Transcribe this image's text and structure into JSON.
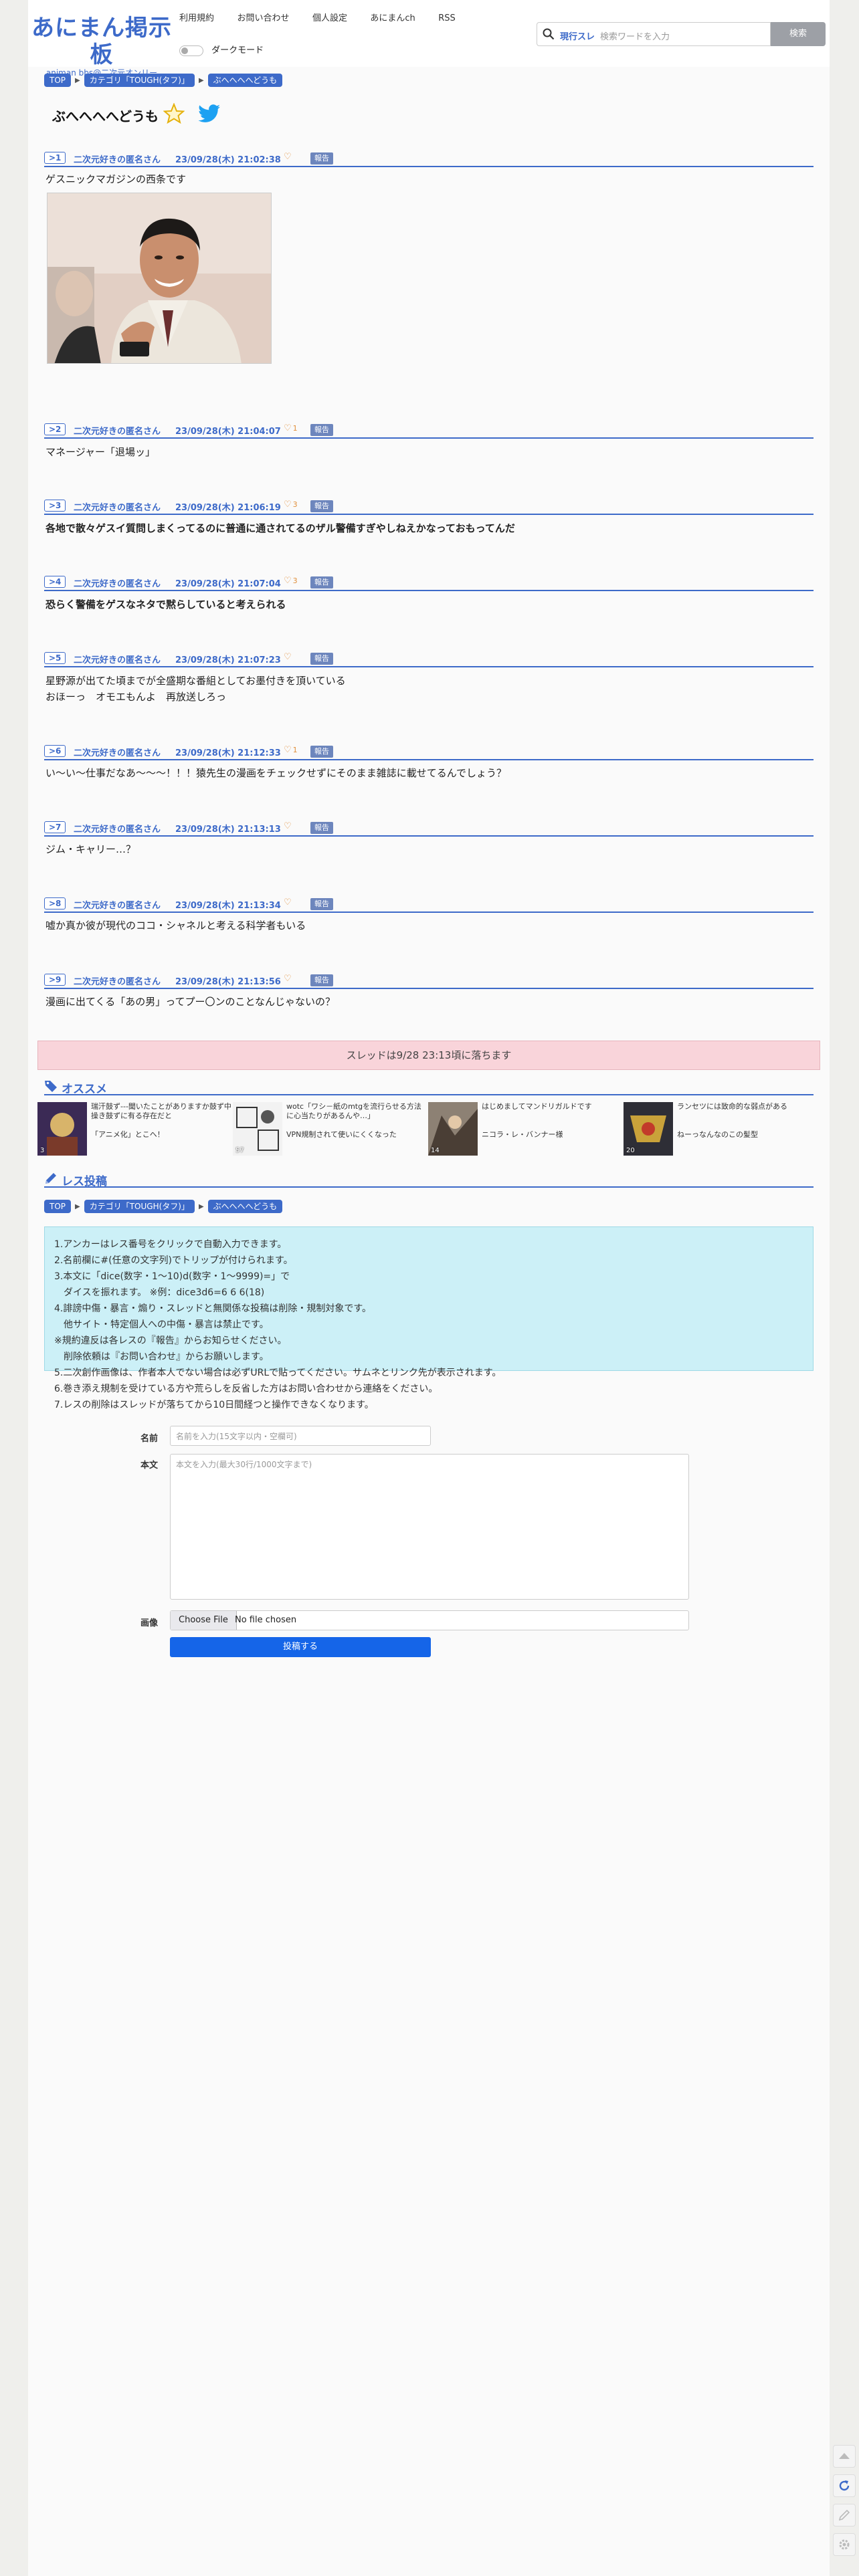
{
  "header": {
    "logo_title": "あにまん掲示板",
    "logo_sub": "animan bbs@二次元オンリー",
    "nav": [
      "利用規約",
      "お問い合わせ",
      "個人設定",
      "あにまんch",
      "RSS"
    ],
    "dark_mode_label": "ダークモード",
    "search_scope": "現行スレ",
    "search_placeholder": "検索ワードを入力",
    "search_button": "検索"
  },
  "breadcrumb": {
    "top": "TOP",
    "category": "カテゴリ「TOUGH(タフ)」",
    "thread": "ぶへへへへどうも"
  },
  "thread": {
    "title": "ぶへへへへどうも",
    "report_label": "報告",
    "posts": [
      {
        "num": "1",
        "name": "二次元好きの匿名さん",
        "date": "23/09/28(木) 21:02:38",
        "likes": "",
        "text": "ゲスニックマガジンの西条です"
      },
      {
        "num": "2",
        "name": "二次元好きの匿名さん",
        "date": "23/09/28(木) 21:04:07",
        "likes": "1",
        "text": "マネージャー「退場ッ」"
      },
      {
        "num": "3",
        "name": "二次元好きの匿名さん",
        "date": "23/09/28(木) 21:06:19",
        "likes": "3",
        "text": "各地で散々ゲスイ質問しまくってるのに普通に通されてるのザル警備すぎやしねえかなっておもってんだ"
      },
      {
        "num": "4",
        "name": "二次元好きの匿名さん",
        "date": "23/09/28(木) 21:07:04",
        "likes": "3",
        "text": "恐らく警備をゲスなネタで黙らしていると考えられる"
      },
      {
        "num": "5",
        "name": "二次元好きの匿名さん",
        "date": "23/09/28(木) 21:07:23",
        "likes": "",
        "text": "星野源が出てた頃までが全盛期な番組としてお墨付きを頂いている\nおほーっ　オモエもんよ　再放送しろっ"
      },
      {
        "num": "6",
        "name": "二次元好きの匿名さん",
        "date": "23/09/28(木) 21:12:33",
        "likes": "1",
        "text": "い〜い〜仕事だなあ〜〜〜！！！猿先生の漫画をチェックせずにそのまま雑誌に載せてるんでしょう？"
      },
      {
        "num": "7",
        "name": "二次元好きの匿名さん",
        "date": "23/09/28(木) 21:13:13",
        "likes": "",
        "text": "ジム・キャリー…？"
      },
      {
        "num": "8",
        "name": "二次元好きの匿名さん",
        "date": "23/09/28(木) 21:13:34",
        "likes": "",
        "text": "嘘か真か彼が現代のココ・シャネルと考える科学者もいる"
      },
      {
        "num": "9",
        "name": "二次元好きの匿名さん",
        "date": "23/09/28(木) 21:13:56",
        "likes": "",
        "text": "漫画に出てくる「あの男」ってプー〇ンのことなんじゃないの？"
      }
    ],
    "drop_notice": "スレッドは9/28 23:13頃に落ちます"
  },
  "recommend": {
    "heading": "オススメ",
    "items": [
      {
        "title": "瑞汗鼓ず---聞いたことがありますか鼓ず中操き鼓ずに有る存在だと",
        "sub": "「アニメ化」とこへ！",
        "count": "3"
      },
      {
        "title": "wotc「ワシ－紙のmtgを流行らせる方法に心当たりがあるんや…」",
        "sub": "VPN規制されて使いにくくなった",
        "count": "57"
      },
      {
        "title": "はじめましてマンドリガルドです",
        "sub": "ニコラ・レ・バンナー様",
        "count": "14"
      },
      {
        "title": "ランセツには致命的な弱点がある",
        "sub": "ねーっなんなのこの髪型",
        "count": "20"
      }
    ]
  },
  "reply": {
    "heading": "レス投稿",
    "rules": [
      "1.アンカーはレス番号をクリックで自動入力できます。",
      "2.名前欄に#(任意の文字列)でトリップが付けられます。",
      "3.本文に「dice(数字・1〜10)d(数字・1〜9999)=」で",
      "　ダイスを振れます。 ※例：dice3d6=6 6 6(18)",
      "4.誹謗中傷・暴言・煽り・スレッドと無関係な投稿は削除・規制対象です。",
      "　他サイト・特定個人への中傷・暴言は禁止です。",
      "※規約違反は各レスの『報告』からお知らせください。",
      "　削除依頼は『お問い合わせ』からお願いします。",
      "5.二次創作画像は、作者本人でない場合は必ずURLで貼ってください。サムネとリンク先が表示されます。",
      "6.巻き添え規制を受けている方や荒らしを反省した方はお問い合わせから連絡をください。",
      "7.レスの削除はスレッドが落ちてから10日間経つと操作できなくなります。"
    ],
    "name_label": "名前",
    "name_placeholder": "名前を入力(15文字以内・空欄可)",
    "body_label": "本文",
    "body_placeholder": "本文を入力(最大30行/1000文字まで)",
    "image_label": "画像",
    "file_button": "Choose File",
    "file_status": "No file chosen",
    "submit_label": "投稿する"
  },
  "colors": {
    "accent": "#3d6ac9",
    "report": "#6d86bd",
    "banner": "#f9d4da",
    "rules_bg": "#ccf0f7",
    "submit": "#1565e8",
    "heart": "#e08f3b"
  }
}
